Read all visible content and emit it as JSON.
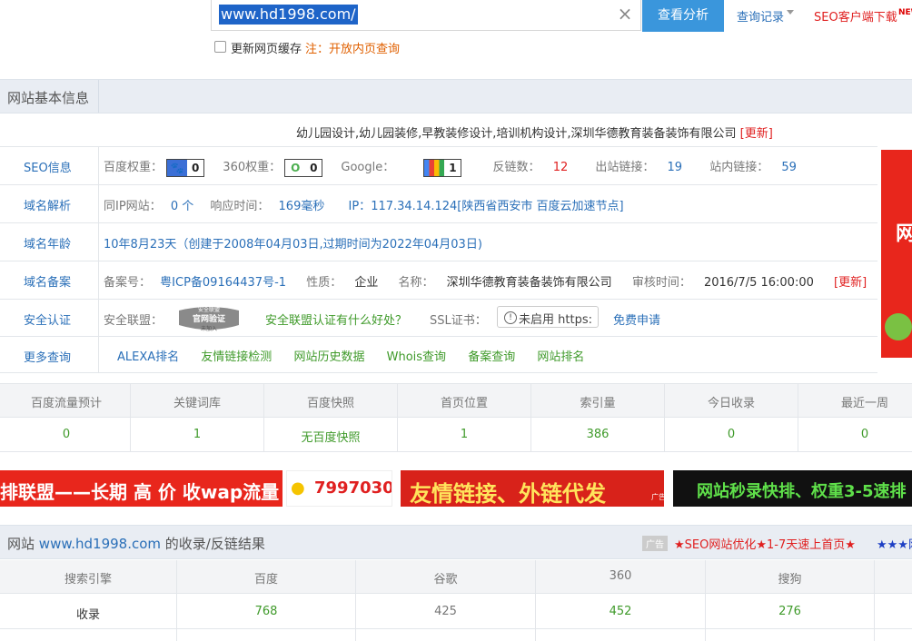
{
  "search": {
    "value": "www.hd1998.com/",
    "analyze_label": "查看分析",
    "query_log_label": "查询记录",
    "seo_client_label": "SEO客户端下载",
    "new_tag": "NEW",
    "cache_label": "更新网页缓存",
    "cache_note": "注：开放内页查询"
  },
  "basic_info": {
    "title": "网站基本信息",
    "site_title": "幼儿园设计,幼儿园装修,早教装修设计,培训机构设计,深圳华德教育装备装饰有限公司",
    "update_label": "[更新]",
    "seo": {
      "label": "SEO信息",
      "baidu_weight_label": "百度权重：",
      "baidu_weight": "0",
      "w360_label": "360权重：",
      "w360": "0",
      "google_label": "Google：",
      "google": "1",
      "backlinks_label": "反链数：",
      "backlinks": "12",
      "outlinks_label": "出站链接：",
      "outlinks": "19",
      "inlinks_label": "站内链接：",
      "inlinks": "59"
    },
    "dns": {
      "label": "域名解析",
      "same_ip_label": "同IP网站：",
      "same_ip": "0 个",
      "response_label": "响应时间：",
      "response": "169毫秒",
      "ip_label": "IP：",
      "ip": "117.34.14.124[陕西省西安市 百度云加速节点]"
    },
    "age": {
      "label": "域名年龄",
      "value": "10年8月23天（创建于2008年04月03日,过期时间为2022年04月03日)"
    },
    "icp": {
      "label": "域名备案",
      "num_label": "备案号：",
      "num": "粤ICP备09164437号-1",
      "nature_label": "性质：",
      "nature": "企业",
      "name_label": "名称：",
      "name": "深圳华德教育装备装饰有限公司",
      "audit_label": "审核时间：",
      "audit": "2016/7/5 16:00:00",
      "update_label": "[更新]"
    },
    "security": {
      "label": "安全认证",
      "alliance_label": "安全联盟：",
      "seal_top": "安全联盟",
      "seal_main": "官网验证",
      "seal_bottom": "未加入",
      "alliance_link": "安全联盟认证有什么好处？",
      "ssl_label": "SSL证书：",
      "https_text": "未启用 https:",
      "free_apply": "免费申请"
    },
    "more": {
      "label": "更多查询",
      "links": [
        "ALEXA排名",
        "友情链接检测",
        "网站历史数据",
        "Whois查询",
        "备案查询",
        "网站排名"
      ]
    }
  },
  "stats": {
    "headers": [
      "百度流量预计",
      "关键词库",
      "百度快照",
      "首页位置",
      "索引量",
      "今日收录",
      "最近一周"
    ],
    "values": [
      "0",
      "1",
      "无百度快照",
      "1",
      "386",
      "0",
      "0"
    ]
  },
  "ads": {
    "ad1": "排联盟——长期 高 价 收wap流量",
    "ad2": "7997030",
    "ad3": "友情链接、外链代发",
    "ad3_tag": "广告",
    "ad4": "网站秒录快排、权重3-5速排",
    "side_ad_text": "网"
  },
  "index_section": {
    "title_prefix": "网站",
    "domain": "www.hd1998.com",
    "title_suffix": "的收录/反链结果",
    "ad_tag": "广告",
    "promo1": "★SEO网站优化★1-7天速上首页★",
    "promo2": "★★★网",
    "headers": [
      "搜索引擎",
      "百度",
      "谷歌",
      "360",
      "搜狗"
    ],
    "row_label": "收录",
    "row_values": [
      "768",
      "425",
      "452",
      "276"
    ]
  },
  "colors": {
    "accent_blue": "#3a96dc",
    "link_blue": "#2a6fb8",
    "red": "#e02020",
    "green": "#3f9a2a"
  }
}
